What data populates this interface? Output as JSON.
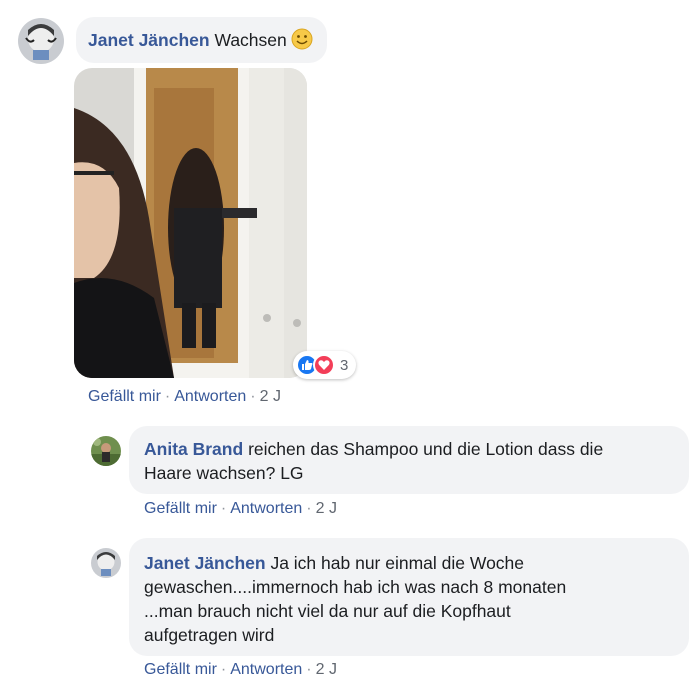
{
  "comments": [
    {
      "author": "Janet Jänchen",
      "text": "Wachsen",
      "emoji": "smiling-face",
      "has_photo": true,
      "reactions": {
        "types": [
          "like",
          "love"
        ],
        "count": "3"
      },
      "actions": {
        "like": "Gefällt mir",
        "separator": "·",
        "reply": "Antworten",
        "time": "2 J"
      }
    },
    {
      "author": "Anita Brand",
      "text_lines": [
        "reichen das Shampoo und die Lotion dass die",
        "Haare wachsen? LG"
      ],
      "actions": {
        "like": "Gefällt mir",
        "separator": "·",
        "reply": "Antworten",
        "time": "2 J"
      }
    },
    {
      "author": "Janet Jänchen",
      "text_lines": [
        "Ja ich hab nur einmal die Woche",
        "gewaschen....immernoch hab ich was nach 8 monaten",
        "...man brauch nicht viel da nur auf die Kopfhaut",
        "aufgetragen wird"
      ],
      "actions": {
        "like": "Gefällt mir",
        "separator": "·",
        "reply": "Antworten",
        "time": "2 J"
      }
    }
  ],
  "colors": {
    "author": "#385898",
    "bubble": "#f2f3f5",
    "like_reaction": "#1877f2",
    "love_reaction": "#f33e58"
  }
}
